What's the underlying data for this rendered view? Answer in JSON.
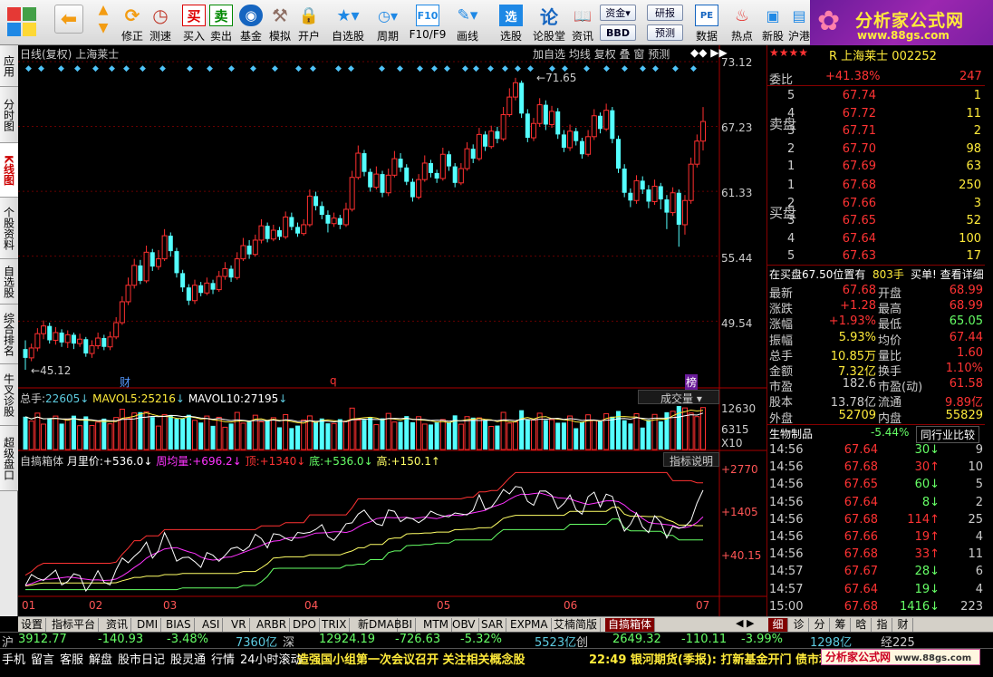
{
  "toolbar": {
    "buttons": [
      {
        "label": "修正",
        "icon": "refresh-icon"
      },
      {
        "label": "测速",
        "icon": "clock-icon"
      },
      {
        "label": "买入",
        "icon": "buy-icon"
      },
      {
        "label": "卖出",
        "icon": "sell-icon"
      },
      {
        "label": "基金",
        "icon": "fund-icon"
      },
      {
        "label": "模拟",
        "icon": "hammer-icon"
      },
      {
        "label": "开户",
        "icon": "lock-icon"
      },
      {
        "label": "自选股",
        "icon": "star-icon"
      },
      {
        "label": "周期",
        "icon": "period-icon"
      },
      {
        "label": "F10/F9",
        "icon": "f10-icon"
      },
      {
        "label": "画线",
        "icon": "pencil-icon"
      },
      {
        "label": "选股",
        "icon": "select-icon"
      },
      {
        "label": "论股堂",
        "icon": "forum-icon"
      },
      {
        "label": "资讯",
        "icon": "news-icon"
      },
      {
        "label": "数据",
        "icon": "data-icon"
      },
      {
        "label": "热点",
        "icon": "hot-icon"
      },
      {
        "label": "新股",
        "icon": "newstock-icon"
      },
      {
        "label": "沪港",
        "icon": "hk-icon"
      }
    ],
    "small": {
      "fund": "资金",
      "bbd": "BBD",
      "research": "研报",
      "forecast": "预测"
    },
    "buy_glyph": "买",
    "sell_glyph": "卖",
    "sel_glyph": "选",
    "bbd_glyph": "BBD",
    "pe_glyph": "PE",
    "f10_glyph": "F10",
    "fund_glyph": "资金"
  },
  "logo": {
    "title": "分析家公式网",
    "url": "www.88gs.com"
  },
  "left_tabs": [
    "应用",
    "分时图",
    "K线图",
    "个股资料",
    "自选股",
    "综合排名",
    "牛叉诊股",
    "超级盘口"
  ],
  "chart_header": {
    "period": "日线(复权)",
    "name": "上海莱士",
    "buttons": [
      "加自选",
      "均线",
      "复权",
      "叠",
      "窗",
      "预测"
    ]
  },
  "price_axis": [
    "73.12",
    "67.23",
    "61.33",
    "55.44",
    "49.54"
  ],
  "price_markers": {
    "high": "71.65",
    "low": "45.12",
    "mark1": "财",
    "mark2": "q",
    "mark3": "榜"
  },
  "volume": {
    "total_label": "总手:",
    "total": "22605",
    "ma5_label": "MAVOL5:",
    "ma5": "25216",
    "ma10_label": "MAVOL10:",
    "ma10": "27195",
    "selector": "成交量",
    "axis": [
      "12630",
      "6315",
      "X10"
    ]
  },
  "indicator": {
    "name": "自搞箱体",
    "items": [
      {
        "label": "月里价:",
        "value": "+536.0",
        "color": "#ffffff"
      },
      {
        "label": "周均量:",
        "value": "+696.2",
        "color": "#ff33ff"
      },
      {
        "label": "顶:",
        "value": "+1340",
        "color": "#ff3333"
      },
      {
        "label": "底:",
        "value": "+536.0",
        "color": "#66ff66"
      },
      {
        "label": "高:",
        "value": "+150.1",
        "color": "#ffff66"
      }
    ],
    "help": "指标说明",
    "axis": [
      "+2770",
      "+1405",
      "+40.15"
    ]
  },
  "x_axis": [
    "01",
    "02",
    "03",
    "04",
    "05",
    "06",
    "07"
  ],
  "chart_data": {
    "type": "candlestick",
    "title": "日线(复权) 上海莱士",
    "ylim": [
      45.12,
      73.12
    ],
    "y_ticks": [
      49.54,
      55.44,
      61.33,
      67.23,
      73.12
    ],
    "x_months": [
      "01",
      "02",
      "03",
      "04",
      "05",
      "06",
      "07"
    ],
    "high": 71.65,
    "low": 45.12,
    "candles": [
      [
        47.0,
        46.2,
        47.8,
        45.12
      ],
      [
        46.2,
        47.1,
        47.5,
        45.9
      ],
      [
        47.1,
        48.4,
        48.9,
        46.8
      ],
      [
        48.4,
        49.1,
        49.6,
        47.9
      ],
      [
        49.1,
        47.8,
        49.4,
        47.5
      ],
      [
        47.8,
        48.5,
        49.0,
        47.4
      ],
      [
        48.5,
        47.6,
        48.8,
        47.2
      ],
      [
        47.6,
        48.3,
        48.7,
        47.1
      ],
      [
        48.3,
        47.5,
        48.5,
        47.0
      ],
      [
        47.5,
        47.9,
        48.4,
        47.2
      ],
      [
        47.9,
        46.6,
        48.1,
        46.3
      ],
      [
        46.6,
        47.3,
        47.8,
        46.2
      ],
      [
        47.3,
        48.0,
        48.5,
        47.0
      ],
      [
        48.0,
        47.2,
        48.3,
        46.9
      ],
      [
        47.2,
        48.1,
        48.6,
        46.9
      ],
      [
        48.1,
        49.4,
        49.9,
        47.9
      ],
      [
        49.4,
        51.3,
        51.8,
        49.2
      ],
      [
        51.3,
        52.8,
        53.5,
        51.0
      ],
      [
        52.8,
        54.6,
        55.2,
        52.5
      ],
      [
        54.6,
        53.2,
        55.1,
        52.9
      ],
      [
        53.2,
        55.8,
        56.4,
        53.0
      ],
      [
        55.8,
        54.5,
        56.1,
        54.1
      ],
      [
        54.5,
        55.2,
        56.0,
        54.2
      ],
      [
        55.2,
        57.3,
        57.9,
        55.0
      ],
      [
        57.3,
        55.9,
        57.6,
        55.4
      ],
      [
        55.9,
        53.9,
        56.2,
        53.5
      ],
      [
        53.9,
        52.6,
        54.2,
        52.2
      ],
      [
        52.6,
        51.4,
        52.9,
        51.0
      ],
      [
        51.4,
        52.8,
        53.3,
        51.1
      ],
      [
        52.8,
        52.1,
        53.1,
        51.8
      ],
      [
        52.1,
        53.0,
        53.5,
        51.9
      ],
      [
        53.0,
        52.4,
        53.3,
        52.0
      ],
      [
        52.4,
        53.6,
        54.1,
        52.2
      ],
      [
        53.6,
        54.3,
        54.9,
        53.3
      ],
      [
        54.3,
        53.5,
        54.6,
        53.1
      ],
      [
        53.5,
        55.2,
        55.8,
        53.3
      ],
      [
        55.2,
        56.4,
        57.1,
        55.0
      ],
      [
        56.4,
        55.6,
        56.9,
        55.2
      ],
      [
        55.6,
        56.9,
        57.4,
        55.4
      ],
      [
        56.9,
        58.2,
        58.8,
        56.6
      ],
      [
        58.2,
        57.0,
        58.5,
        56.7
      ],
      [
        57.0,
        57.8,
        58.3,
        56.8
      ],
      [
        57.8,
        57.2,
        58.1,
        56.9
      ],
      [
        57.2,
        59.0,
        59.5,
        57.0
      ],
      [
        59.0,
        58.1,
        59.4,
        57.8
      ],
      [
        58.1,
        57.5,
        58.5,
        57.2
      ],
      [
        57.5,
        58.3,
        58.8,
        57.3
      ],
      [
        58.3,
        60.9,
        61.5,
        58.1
      ],
      [
        60.9,
        60.0,
        61.3,
        59.6
      ],
      [
        60.0,
        59.2,
        60.4,
        58.8
      ],
      [
        59.2,
        58.4,
        59.6,
        57.6
      ],
      [
        58.4,
        58.9,
        59.4,
        58.1
      ],
      [
        58.9,
        58.3,
        59.2,
        57.9
      ],
      [
        58.3,
        59.7,
        60.3,
        58.1
      ],
      [
        59.7,
        62.6,
        63.2,
        59.5
      ],
      [
        62.6,
        64.8,
        65.5,
        62.4
      ],
      [
        64.8,
        63.1,
        65.1,
        62.7
      ],
      [
        63.1,
        61.7,
        63.4,
        61.3
      ],
      [
        61.7,
        62.9,
        63.6,
        61.5
      ],
      [
        62.9,
        61.2,
        63.2,
        60.8
      ],
      [
        61.2,
        62.8,
        63.4,
        60.9
      ],
      [
        62.8,
        64.3,
        65.0,
        62.6
      ],
      [
        64.3,
        63.5,
        64.8,
        63.1
      ],
      [
        63.5,
        62.2,
        63.8,
        61.9
      ],
      [
        62.2,
        60.8,
        62.5,
        60.4
      ],
      [
        60.8,
        62.4,
        62.9,
        60.6
      ],
      [
        62.4,
        63.9,
        64.6,
        62.2
      ],
      [
        63.9,
        63.0,
        64.2,
        62.6
      ],
      [
        63.0,
        62.5,
        63.3,
        62.1
      ],
      [
        62.5,
        64.7,
        65.3,
        62.3
      ],
      [
        64.7,
        63.6,
        65.0,
        63.2
      ],
      [
        63.6,
        62.1,
        63.9,
        61.7
      ],
      [
        62.1,
        63.4,
        63.9,
        61.9
      ],
      [
        63.4,
        65.2,
        65.8,
        63.2
      ],
      [
        65.2,
        64.3,
        65.6,
        63.9
      ],
      [
        64.3,
        66.5,
        67.1,
        64.1
      ],
      [
        66.5,
        65.4,
        66.8,
        65.0
      ],
      [
        65.4,
        66.8,
        67.3,
        65.2
      ],
      [
        66.8,
        66.1,
        67.2,
        65.7
      ],
      [
        66.1,
        68.3,
        69.0,
        65.9
      ],
      [
        68.3,
        69.9,
        70.7,
        68.1
      ],
      [
        69.9,
        71.2,
        71.65,
        69.6
      ],
      [
        71.2,
        68.4,
        71.4,
        68.0
      ],
      [
        68.4,
        66.2,
        68.8,
        65.8
      ],
      [
        66.2,
        67.5,
        68.0,
        65.9
      ],
      [
        67.5,
        69.2,
        69.8,
        67.2
      ],
      [
        69.2,
        67.4,
        69.6,
        66.9
      ],
      [
        67.4,
        68.6,
        69.1,
        67.1
      ],
      [
        68.6,
        66.5,
        68.9,
        66.1
      ],
      [
        66.5,
        65.3,
        66.9,
        64.9
      ],
      [
        65.3,
        66.8,
        67.4,
        65.0
      ],
      [
        66.8,
        65.9,
        67.1,
        65.5
      ],
      [
        65.9,
        64.7,
        66.2,
        64.3
      ],
      [
        64.7,
        66.3,
        66.9,
        64.5
      ],
      [
        66.3,
        68.2,
        68.8,
        66.0
      ],
      [
        68.2,
        67.0,
        68.5,
        66.6
      ],
      [
        67.0,
        68.7,
        69.3,
        66.8
      ],
      [
        68.7,
        66.1,
        69.0,
        65.7
      ],
      [
        66.1,
        63.4,
        66.4,
        63.0
      ],
      [
        63.4,
        61.2,
        63.8,
        60.8
      ],
      [
        61.2,
        60.5,
        61.6,
        59.9
      ],
      [
        60.5,
        62.3,
        62.8,
        60.2
      ],
      [
        62.3,
        61.5,
        62.7,
        61.1
      ],
      [
        61.5,
        60.4,
        61.9,
        59.8
      ],
      [
        60.4,
        61.8,
        62.4,
        60.1
      ],
      [
        61.8,
        60.6,
        62.1,
        59.7
      ],
      [
        60.6,
        59.4,
        61.0,
        57.9
      ],
      [
        59.4,
        61.2,
        61.7,
        59.1
      ],
      [
        61.2,
        58.3,
        61.5,
        56.3
      ],
      [
        58.3,
        60.5,
        61.0,
        57.4
      ],
      [
        60.5,
        63.8,
        64.4,
        60.2
      ],
      [
        63.8,
        65.9,
        66.5,
        63.5
      ],
      [
        65.9,
        67.68,
        68.99,
        65.05
      ]
    ],
    "volume": {
      "max": 12630,
      "mid": 6315,
      "current": 22605,
      "ma5": 25216,
      "ma10": 27195
    },
    "indicator_series": {
      "name": "自搞箱体",
      "current": {
        "月里价": 536.0,
        "周均量": 696.2,
        "顶": 1340,
        "底": 536.0,
        "高": 150.1
      }
    }
  },
  "quote": {
    "stars": "★★★★",
    "name_line": "R 上海莱士 002252",
    "weibi_label": "委比",
    "weibi": "+41.38%",
    "weicha": "247",
    "sell": [
      {
        "n": "5",
        "p": "67.74",
        "v": "1"
      },
      {
        "n": "4",
        "p": "67.72",
        "v": "11"
      },
      {
        "n": "3",
        "p": "67.71",
        "v": "2"
      },
      {
        "n": "2",
        "p": "67.70",
        "v": "98"
      },
      {
        "n": "1",
        "p": "67.69",
        "v": "63"
      }
    ],
    "buy": [
      {
        "n": "1",
        "p": "67.68",
        "v": "250"
      },
      {
        "n": "2",
        "p": "67.66",
        "v": "3"
      },
      {
        "n": "3",
        "p": "67.65",
        "v": "52"
      },
      {
        "n": "4",
        "p": "67.64",
        "v": "100"
      },
      {
        "n": "5",
        "p": "67.63",
        "v": "17"
      }
    ],
    "sell_label": "卖盘",
    "buy_label": "买盘",
    "pos_line": "在买盘67.50位置有",
    "pos_qty": "803手",
    "pos_btn": "买单! 查看详细",
    "stats": [
      {
        "l1": "最新",
        "v1": "67.68",
        "l2": "开盘",
        "v2": "68.99"
      },
      {
        "l1": "涨跌",
        "v1": "+1.28",
        "l2": "最高",
        "v2": "68.99"
      },
      {
        "l1": "涨幅",
        "v1": "+1.93%",
        "l2": "最低",
        "v2": "65.05"
      },
      {
        "l1": "振幅",
        "v1": "5.93%",
        "l2": "均价",
        "v2": "67.44"
      },
      {
        "l1": "总手",
        "v1": "10.85万",
        "l2": "量比",
        "v2": "1.60"
      },
      {
        "l1": "金额",
        "v1": "7.32亿",
        "l2": "换手",
        "v2": "1.10%"
      },
      {
        "l1": "市盈",
        "v1": "182.6",
        "l2": "市盈(动)",
        "v2": "61.58"
      },
      {
        "l1": "股本",
        "v1": "13.78亿",
        "l2": "流通",
        "v2": "9.89亿"
      },
      {
        "l1": "外盘",
        "v1": "52709",
        "l2": "内盘",
        "v2": "55829"
      }
    ],
    "sector": "生物制品",
    "sector_chg": "-5.44%",
    "compare": "同行业比较",
    "ticks": [
      {
        "t": "14:56",
        "p": "67.64",
        "v": "30",
        "d": "down",
        "n": "9"
      },
      {
        "t": "14:56",
        "p": "67.68",
        "v": "30",
        "d": "up",
        "n": "10"
      },
      {
        "t": "14:56",
        "p": "67.65",
        "v": "60",
        "d": "down",
        "n": "5"
      },
      {
        "t": "14:56",
        "p": "67.64",
        "v": "8",
        "d": "down",
        "n": "2"
      },
      {
        "t": "14:56",
        "p": "67.68",
        "v": "114",
        "d": "up",
        "n": "25"
      },
      {
        "t": "14:56",
        "p": "67.66",
        "v": "19",
        "d": "up",
        "n": "4"
      },
      {
        "t": "14:56",
        "p": "67.68",
        "v": "33",
        "d": "up",
        "n": "11"
      },
      {
        "t": "14:57",
        "p": "67.67",
        "v": "28",
        "d": "down",
        "n": "6"
      },
      {
        "t": "14:57",
        "p": "67.64",
        "v": "19",
        "d": "down",
        "n": "4"
      },
      {
        "t": "15:00",
        "p": "67.68",
        "v": "1416",
        "d": "down",
        "n": "223"
      }
    ]
  },
  "bottom_tabs": [
    "设置",
    "指标平台",
    "资讯",
    "DMI",
    "BIAS",
    "ASI",
    "VR",
    "ARBR",
    "DPO",
    "TRIX",
    "新DMA",
    "BBI",
    "MTM",
    "OBV",
    "SAR",
    "EXPMA",
    "艾楠简版",
    "自搞箱体"
  ],
  "right_tabs": [
    "细",
    "诊",
    "分",
    "筹",
    "晗",
    "指",
    "财"
  ],
  "status1": {
    "sh": "沪",
    "sh_idx": "3912.77",
    "sh_chg": "-140.93",
    "sh_pct": "-3.48%",
    "sh_amt": "7360亿",
    "sz": "深",
    "sz_idx": "12924.19",
    "sz_chg": "-726.63",
    "sz_pct": "-5.32%",
    "sz_amt": "5523亿",
    "cy": "创",
    "cy_idx": "2649.32",
    "cy_chg": "-110.11",
    "cy_pct": "-3.99%",
    "last": "1298亿",
    "last2": "经225"
  },
  "status2": {
    "items": [
      "手机",
      "留言",
      "客服",
      "解盘",
      "股市日记",
      "股灵通",
      "行情",
      "24小时滚动"
    ],
    "news1": "造强国小组第一次会议召开 关注相关概念股",
    "news2": "22:49 银河期货(季报): 打新基金开门 债市利率",
    "watermark": "分析家公式网",
    "watermark_url": "www.88gs.com"
  }
}
